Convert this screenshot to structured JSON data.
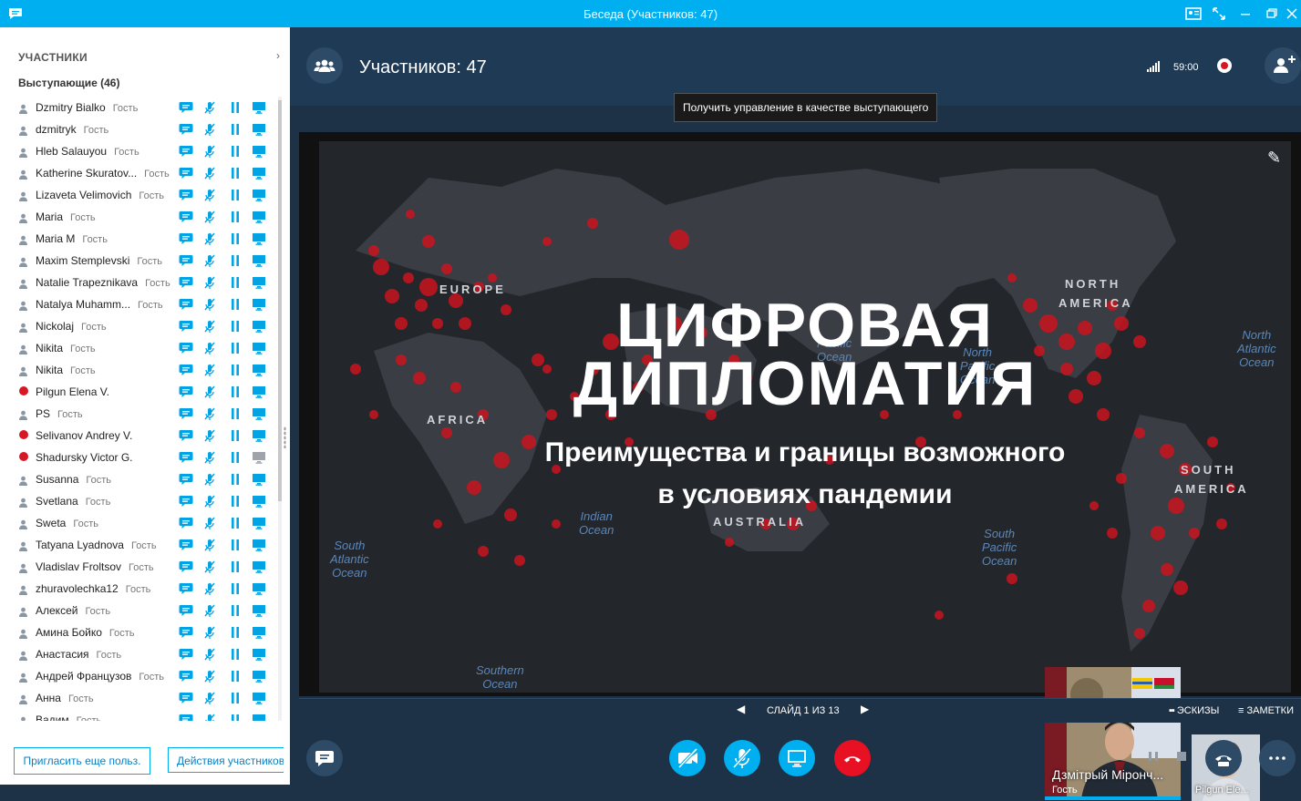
{
  "window": {
    "title": "Беседа (Участников: 47)",
    "accent": "#00aff0"
  },
  "sidebar": {
    "heading": "УЧАСТНИКИ",
    "presenters_heading": "Выступающие (46)",
    "participants": [
      {
        "name": "Dzmitry Bialko",
        "guest": "Гость",
        "status": "person",
        "screen_active": true
      },
      {
        "name": "dzmitryk",
        "guest": "Гость",
        "status": "person",
        "screen_active": true
      },
      {
        "name": "Hleb Salauyou",
        "guest": "Гость",
        "status": "person",
        "screen_active": true
      },
      {
        "name": "Katherine Skuratov...",
        "guest": "Гость",
        "status": "person",
        "screen_active": true
      },
      {
        "name": "Lizaveta Velimovich",
        "guest": "Гость",
        "status": "person",
        "screen_active": true
      },
      {
        "name": "Maria",
        "guest": "Гость",
        "status": "person",
        "screen_active": true
      },
      {
        "name": "Maria M",
        "guest": "Гость",
        "status": "person",
        "screen_active": true
      },
      {
        "name": "Maxim Stemplevski",
        "guest": "Гость",
        "status": "person",
        "screen_active": true
      },
      {
        "name": "Natalie Trapeznikava",
        "guest": "Гость",
        "status": "person",
        "screen_active": true
      },
      {
        "name": "Natalya Muhamm...",
        "guest": "Гость",
        "status": "person",
        "screen_active": true
      },
      {
        "name": "Nickolaj",
        "guest": "Гость",
        "status": "person",
        "screen_active": true
      },
      {
        "name": "Nikita",
        "guest": "Гость",
        "status": "person",
        "screen_active": true
      },
      {
        "name": "Nikita",
        "guest": "Гость",
        "status": "person",
        "screen_active": true
      },
      {
        "name": "Pilgun Elena V.",
        "guest": "",
        "status": "busy",
        "screen_active": true
      },
      {
        "name": "PS",
        "guest": "Гость",
        "status": "person",
        "screen_active": true
      },
      {
        "name": "Selivanov Andrey V.",
        "guest": "",
        "status": "busy",
        "screen_active": true
      },
      {
        "name": "Shadursky Victor G.",
        "guest": "",
        "status": "busy",
        "screen_active": false
      },
      {
        "name": "Susanna",
        "guest": "Гость",
        "status": "person",
        "screen_active": true
      },
      {
        "name": "Svetlana",
        "guest": "Гость",
        "status": "person",
        "screen_active": true
      },
      {
        "name": "Sweta",
        "guest": "Гость",
        "status": "person",
        "screen_active": true
      },
      {
        "name": "Tatyana Lyadnova",
        "guest": "Гость",
        "status": "person",
        "screen_active": true
      },
      {
        "name": "Vladislav Froltsov",
        "guest": "Гость",
        "status": "person",
        "screen_active": true
      },
      {
        "name": "zhuravolechka12",
        "guest": "Гость",
        "status": "person",
        "screen_active": true
      },
      {
        "name": "Алексей",
        "guest": "Гость",
        "status": "person",
        "screen_active": true
      },
      {
        "name": "Амина Бойко",
        "guest": "Гость",
        "status": "person",
        "screen_active": true
      },
      {
        "name": "Анастасия",
        "guest": "Гость",
        "status": "person",
        "screen_active": true
      },
      {
        "name": "Андрей Французов",
        "guest": "Гость",
        "status": "person",
        "screen_active": true
      },
      {
        "name": "Анна",
        "guest": "Гость",
        "status": "person",
        "screen_active": true
      },
      {
        "name": "Вадим",
        "guest": "Гость",
        "status": "person",
        "screen_active": true
      }
    ],
    "invite_button": "Пригласить еще польз.",
    "actions_button": "Действия участников"
  },
  "header": {
    "participant_count": "Участников: 47",
    "timer": "59:00",
    "tooltip": "Получить управление в качестве выступающего"
  },
  "slide": {
    "title_line1": "ЦИФРОВАЯ",
    "title_line2": "ДИПЛОМАТИЯ",
    "subtitle_line1": "Преимущества и границы возможного",
    "subtitle_line2": "в условиях пандемии",
    "labels": {
      "europe": "EUROPE",
      "africa": "AFRICA",
      "australia": "AUSTRALIA",
      "north_america_1": "NORTH",
      "north_america_2": "AMERICA",
      "south_america_1": "SOUTH",
      "south_america_2": "AMERICA",
      "indian_ocean": "Indian\nOcean",
      "south_atlantic": "South\nAtlantic\nOcean",
      "southern_ocean": "Southern\nOcean",
      "south_pacific": "South\nPacific\nOcean",
      "north_pacific": "North\nPacific\nOcean",
      "north_pacific_left": "Pacific\nOcean",
      "north_atlantic": "North\nAtlantic\nOcean"
    }
  },
  "videos": {
    "main_name": "Дзмітрый Міронч...",
    "main_role": "Гость",
    "small_name": "Pilgun Ele..."
  },
  "slide_nav": {
    "counter": "СЛАЙД 1 ИЗ 13",
    "thumbnails": "ЭСКИЗЫ",
    "notes": "ЗАМЕТКИ"
  },
  "colors": {
    "background": "#1d3247",
    "control_blue": "#00aff0",
    "hangup_red": "#e81123",
    "status_red": "#d51824"
  }
}
